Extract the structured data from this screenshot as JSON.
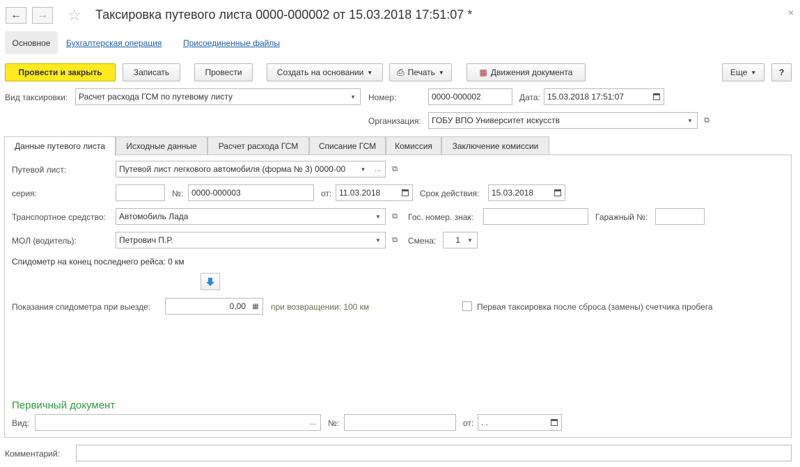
{
  "header": {
    "title": "Таксировка путевого листа 0000-000002 от 15.03.2018 17:51:07 *",
    "back": "←",
    "forward": "→",
    "star": "☆",
    "close": "×"
  },
  "nav": {
    "main": "Основное",
    "links": [
      "Бухгалтерская операция",
      "Присоединенные файлы"
    ]
  },
  "toolbar": {
    "post_close": "Провести и закрыть",
    "save": "Записать",
    "post": "Провести",
    "create_based": "Создать на основании",
    "print": "Печать",
    "movements": "Движения документа",
    "more": "Еще",
    "help": "?"
  },
  "form": {
    "kind_label": "Вид таксировки:",
    "kind_value": "Расчет расхода ГСМ по путевому листу",
    "number_label": "Номер:",
    "number_value": "0000-000002",
    "date_label": "Дата:",
    "date_value": "15.03.2018 17:51:07",
    "org_label": "Организация:",
    "org_value": "ГОБУ ВПО Университет искусств"
  },
  "tabs": [
    "Данные путевого листа",
    "Исходные данные",
    "Расчет расхода ГСМ",
    "Списание ГСМ",
    "Комиссия",
    "Заключение комиссии"
  ],
  "waybill": {
    "waybill_label": "Путевой лист:",
    "waybill_value": "Путевой лист легкового автомобиля (форма № 3) 0000-00",
    "series_label": "серия:",
    "series_value": "",
    "no_label": "№:",
    "no_value": "0000-000003",
    "from_label": "от:",
    "from_value": "11.03.2018",
    "validity_label": "Срок действия:",
    "validity_value": "15.03.2018",
    "vehicle_label": "Транспортное средство:",
    "vehicle_value": "Автомобиль Лада",
    "plate_label": "Гос. номер. знак:",
    "plate_value": "",
    "garage_label": "Гаражный №:",
    "garage_value": "",
    "driver_label": "МОЛ (водитель):",
    "driver_value": "Петрович П.Р.",
    "shift_label": "Смена:",
    "shift_value": "1",
    "speedometer_last": "Спидометр на конец последнего рейса: 0 км",
    "odometer_label": "Показания спидометра при выезде:",
    "odometer_value": "0,00",
    "return_text": "при возвращении: 100 км",
    "first_taxation": "Первая таксировка после сброса (замены) счетчика пробега"
  },
  "primary": {
    "heading": "Первичный документ",
    "kind_label": "Вид:",
    "kind_value": "",
    "no_label": "№:",
    "no_value": "",
    "from_label": "от:",
    "from_value": " .  ."
  },
  "comment": {
    "label": "Комментарий:",
    "value": ""
  },
  "colors": {
    "accent": "#ffea20",
    "link": "#1a5fa8",
    "section": "#2e9c3e"
  }
}
